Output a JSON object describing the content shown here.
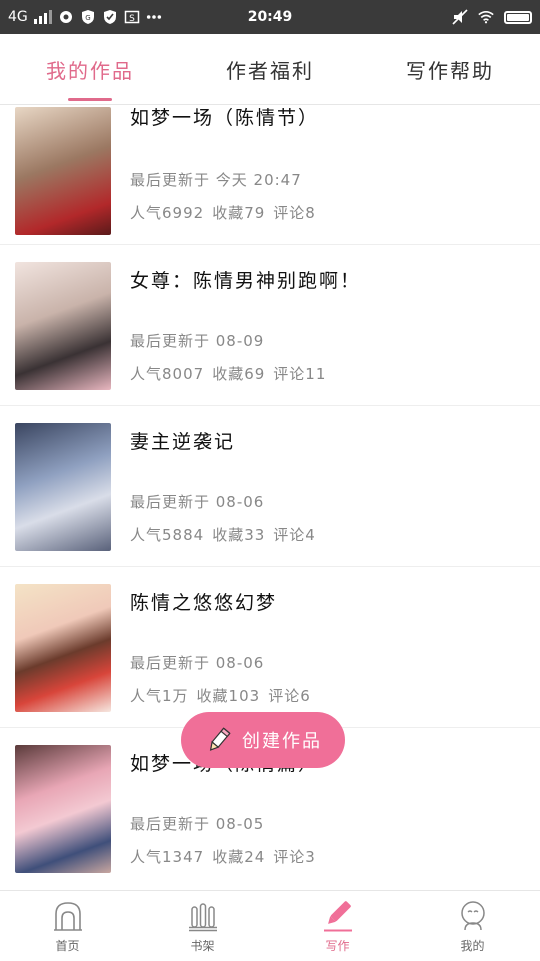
{
  "status_bar": {
    "network": "4G",
    "time": "20:49"
  },
  "tabs": [
    {
      "label": "我的作品",
      "active": true
    },
    {
      "label": "作者福利",
      "active": false
    },
    {
      "label": "写作帮助",
      "active": false
    }
  ],
  "works": [
    {
      "title": "如梦一场（陈情节）",
      "updated": "最后更新于 今天 20:47",
      "popularity": "人气6992",
      "favorites": "收藏79",
      "comments": "评论8",
      "cover_color": "#7a5a4a"
    },
    {
      "title": "女尊：陈情男神别跑啊！",
      "updated": "最后更新于 08-09",
      "popularity": "人气8007",
      "favorites": "收藏69",
      "comments": "评论11",
      "cover_color": "#c8b6b0"
    },
    {
      "title": "妻主逆袭记",
      "updated": "最后更新于 08-06",
      "popularity": "人气5884",
      "favorites": "收藏33",
      "comments": "评论4",
      "cover_color": "#5c6a88"
    },
    {
      "title": "陈情之悠悠幻梦",
      "updated": "最后更新于 08-06",
      "popularity": "人气1万",
      "favorites": "收藏103",
      "comments": "评论6",
      "cover_color": "#d98a7a"
    },
    {
      "title": "如梦一场（陈情篇）",
      "updated": "最后更新于 08-05",
      "popularity": "人气1347",
      "favorites": "收藏24",
      "comments": "评论3",
      "cover_color": "#d69aa8"
    }
  ],
  "fab": {
    "label": "创建作品"
  },
  "bottom_nav": [
    {
      "label": "首页",
      "icon": "home-icon",
      "active": false
    },
    {
      "label": "书架",
      "icon": "bookshelf-icon",
      "active": false
    },
    {
      "label": "写作",
      "icon": "pen-icon",
      "active": true
    },
    {
      "label": "我的",
      "icon": "profile-icon",
      "active": false
    }
  ],
  "colors": {
    "accent": "#e06a8b",
    "fab": "#f06f98"
  }
}
